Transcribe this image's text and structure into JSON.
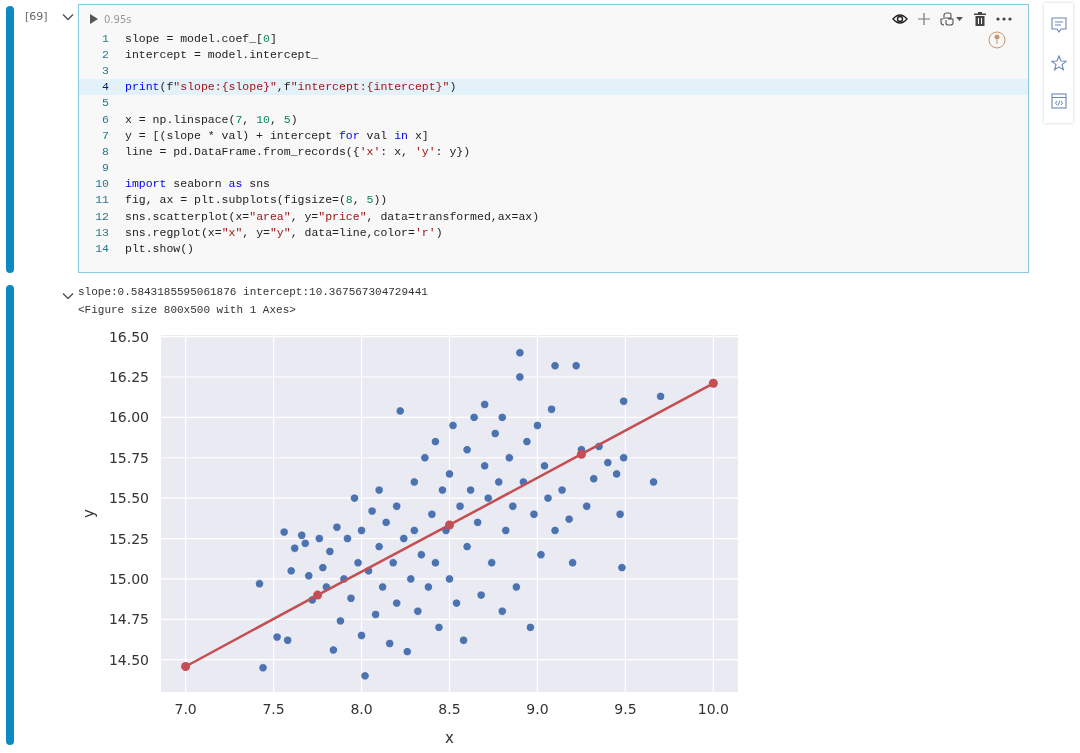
{
  "input_cell": {
    "execution_count": "[69]",
    "expanded": true,
    "run_time": "0.95s",
    "lines": [
      {
        "number": "1",
        "highlighted": false,
        "tokens": [
          {
            "text": "slope = model.coef_[",
            "kind": "plain"
          },
          {
            "text": "0",
            "kind": "number"
          },
          {
            "text": "]",
            "kind": "plain"
          }
        ]
      },
      {
        "number": "2",
        "highlighted": false,
        "tokens": [
          {
            "text": "intercept = model.intercept_",
            "kind": "plain"
          }
        ]
      },
      {
        "number": "3",
        "highlighted": false
      },
      {
        "number": "4",
        "highlighted": true,
        "tokens": [
          {
            "text": "print",
            "kind": "keyword"
          },
          {
            "text": "(f",
            "kind": "plain"
          },
          {
            "text": "\"slope:{slope}\"",
            "kind": "string"
          },
          {
            "text": ",f",
            "kind": "plain"
          },
          {
            "text": "\"intercept:{intercept}\"",
            "kind": "string"
          },
          {
            "text": ")",
            "kind": "plain"
          }
        ]
      },
      {
        "number": "5",
        "highlighted": false
      },
      {
        "number": "6",
        "highlighted": false,
        "tokens": [
          {
            "text": "x = np.linspace(",
            "kind": "plain"
          },
          {
            "text": "7",
            "kind": "number"
          },
          {
            "text": ", ",
            "kind": "plain"
          },
          {
            "text": "10",
            "kind": "number"
          },
          {
            "text": ", ",
            "kind": "plain"
          },
          {
            "text": "5",
            "kind": "number"
          },
          {
            "text": ")",
            "kind": "plain"
          }
        ]
      },
      {
        "number": "7",
        "highlighted": false,
        "tokens": [
          {
            "text": "y = [(slope * val) + intercept ",
            "kind": "plain"
          },
          {
            "text": "for",
            "kind": "keyword"
          },
          {
            "text": " val ",
            "kind": "plain"
          },
          {
            "text": "in",
            "kind": "keyword"
          },
          {
            "text": " x]",
            "kind": "plain"
          }
        ]
      },
      {
        "number": "8",
        "highlighted": false,
        "tokens": [
          {
            "text": "line = pd.DataFrame.from_records({",
            "kind": "plain"
          },
          {
            "text": "'x'",
            "kind": "string"
          },
          {
            "text": ": x, ",
            "kind": "plain"
          },
          {
            "text": "'y'",
            "kind": "string"
          },
          {
            "text": ": y})",
            "kind": "plain"
          }
        ]
      },
      {
        "number": "9",
        "highlighted": false
      },
      {
        "number": "10",
        "highlighted": false,
        "tokens": [
          {
            "text": "import",
            "kind": "keyword"
          },
          {
            "text": " seaborn ",
            "kind": "plain"
          },
          {
            "text": "as",
            "kind": "keyword"
          },
          {
            "text": " sns",
            "kind": "plain"
          }
        ]
      },
      {
        "number": "11",
        "highlighted": false,
        "tokens": [
          {
            "text": "fig, ax = plt.subplots(figsize=(",
            "kind": "plain"
          },
          {
            "text": "8",
            "kind": "number"
          },
          {
            "text": ", ",
            "kind": "plain"
          },
          {
            "text": "5",
            "kind": "number"
          },
          {
            "text": "))",
            "kind": "plain"
          }
        ]
      },
      {
        "number": "12",
        "highlighted": false,
        "tokens": [
          {
            "text": "sns.scatterplot(x=",
            "kind": "plain"
          },
          {
            "text": "\"area\"",
            "kind": "string"
          },
          {
            "text": ", y=",
            "kind": "plain"
          },
          {
            "text": "\"price\"",
            "kind": "string"
          },
          {
            "text": ", data=transformed,ax=ax)",
            "kind": "plain"
          }
        ]
      },
      {
        "number": "13",
        "highlighted": false,
        "tokens": [
          {
            "text": "sns.regplot(x=",
            "kind": "plain"
          },
          {
            "text": "\"x\"",
            "kind": "string"
          },
          {
            "text": ", y=",
            "kind": "plain"
          },
          {
            "text": "\"y\"",
            "kind": "string"
          },
          {
            "text": ", data=line,color=",
            "kind": "plain"
          },
          {
            "text": "'r'",
            "kind": "string"
          },
          {
            "text": ")",
            "kind": "plain"
          }
        ]
      },
      {
        "number": "14",
        "highlighted": false,
        "tokens": [
          {
            "text": "plt.show()",
            "kind": "plain"
          }
        ]
      }
    ]
  },
  "output": {
    "expanded": true,
    "text_lines": [
      "slope:0.5843185595061876 intercept:10.367567304729441",
      "<Figure size 800x500 with 1 Axes>"
    ],
    "chart_data": {
      "type": "scatter",
      "xlabel": "x",
      "ylabel": "y",
      "xlim": [
        6.86,
        10.14
      ],
      "ylim": [
        14.3,
        16.51
      ],
      "xticks": [
        {
          "value": 7,
          "label": "7.0"
        },
        {
          "value": 7.5,
          "label": "7.5"
        },
        {
          "value": 8,
          "label": "8.0"
        },
        {
          "value": 8.5,
          "label": "8.5"
        },
        {
          "value": 9,
          "label": "9.0"
        },
        {
          "value": 9.5,
          "label": "9.5"
        },
        {
          "value": 10,
          "label": "10.0"
        }
      ],
      "yticks": [
        {
          "value": 14.5,
          "label": "14.50"
        },
        {
          "value": 14.75,
          "label": "14.75"
        },
        {
          "value": 15,
          "label": "15.00"
        },
        {
          "value": 15.25,
          "label": "15.25"
        },
        {
          "value": 15.5,
          "label": "15.50"
        },
        {
          "value": 15.75,
          "label": "15.75"
        },
        {
          "value": 16,
          "label": "16.00"
        },
        {
          "value": 16.25,
          "label": "16.25"
        },
        {
          "value": 16.5,
          "label": "16.50"
        }
      ],
      "series": [
        {
          "color": "#4c72b0",
          "x": [
            7.42,
            7.44,
            7.52,
            7.56,
            7.58,
            7.6,
            7.62,
            7.66,
            7.68,
            7.7,
            7.72,
            7.76,
            7.78,
            7.8,
            7.82,
            7.84,
            7.86,
            7.88,
            7.9,
            7.92,
            7.94,
            7.96,
            7.98,
            8.0,
            8.0,
            8.02,
            8.04,
            8.06,
            8.08,
            8.1,
            8.1,
            8.12,
            8.14,
            8.16,
            8.18,
            8.2,
            8.2,
            8.22,
            8.24,
            8.26,
            8.28,
            8.3,
            8.3,
            8.32,
            8.34,
            8.36,
            8.38,
            8.4,
            8.42,
            8.42,
            8.44,
            8.46,
            8.48,
            8.5,
            8.5,
            8.52,
            8.54,
            8.56,
            8.58,
            8.6,
            8.6,
            8.62,
            8.64,
            8.66,
            8.68,
            8.7,
            8.7,
            8.72,
            8.74,
            8.76,
            8.78,
            8.8,
            8.8,
            8.82,
            8.84,
            8.86,
            8.88,
            8.9,
            8.9,
            8.92,
            8.94,
            8.96,
            8.98,
            9.0,
            9.02,
            9.04,
            9.06,
            9.08,
            9.1,
            9.1,
            9.14,
            9.18,
            9.2,
            9.22,
            9.25,
            9.28,
            9.32,
            9.35,
            9.4,
            9.45,
            9.47,
            9.48,
            9.49,
            9.49,
            9.66,
            9.7
          ],
          "values": [
            14.97,
            14.45,
            14.64,
            15.29,
            14.62,
            15.05,
            15.19,
            15.27,
            15.22,
            15.02,
            14.87,
            15.25,
            15.07,
            14.95,
            15.17,
            14.56,
            15.32,
            14.74,
            15.0,
            15.25,
            14.88,
            15.5,
            15.1,
            14.65,
            15.3,
            14.4,
            15.05,
            15.42,
            14.78,
            15.2,
            15.55,
            14.95,
            15.35,
            14.6,
            15.1,
            15.45,
            14.85,
            16.04,
            15.25,
            14.55,
            15.0,
            15.6,
            15.3,
            14.8,
            15.15,
            15.75,
            14.95,
            15.4,
            15.85,
            15.1,
            14.7,
            15.55,
            15.3,
            15.0,
            15.65,
            15.95,
            14.85,
            15.45,
            14.62,
            15.2,
            15.8,
            15.55,
            16.0,
            15.35,
            14.9,
            15.7,
            16.08,
            15.5,
            15.1,
            15.9,
            15.6,
            14.8,
            16.0,
            15.3,
            15.75,
            15.45,
            14.95,
            16.4,
            16.25,
            15.6,
            15.85,
            14.7,
            15.4,
            15.95,
            15.15,
            15.7,
            15.5,
            16.05,
            16.32,
            15.3,
            15.55,
            15.37,
            15.1,
            16.32,
            15.8,
            15.45,
            15.62,
            15.82,
            15.72,
            15.65,
            15.4,
            15.07,
            16.1,
            15.75,
            15.6,
            16.13
          ]
        },
        {
          "type": "line",
          "marker": "circle",
          "color": "#c44e52",
          "x": [
            7,
            7.75,
            8.5,
            9.25,
            10
          ],
          "values": [
            14.458,
            14.9,
            15.334,
            15.772,
            16.211
          ]
        }
      ],
      "grid": true
    }
  }
}
